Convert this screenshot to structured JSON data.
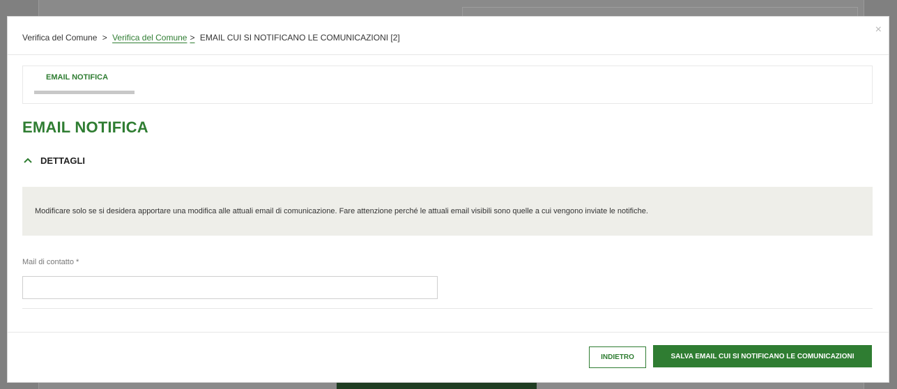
{
  "breadcrumb": {
    "items": [
      "Verifica del Comune",
      "Verifica del Comune",
      "EMAIL CUI SI NOTIFICANO LE COMUNICAZIONI [2]"
    ],
    "separator": ">"
  },
  "modal": {
    "close_symbol": "×"
  },
  "tabs": [
    {
      "label": "EMAIL NOTIFICA"
    }
  ],
  "section": {
    "title": "EMAIL NOTIFICA",
    "accordion_label": "DETTAGLI",
    "accordion_icon": "chevron-up-icon"
  },
  "info": {
    "text": "Modificare solo se si desidera apportare una modifica alle attuali email di comunicazione. Fare attenzione perché le attuali email visibili sono quelle a cui vengono inviate le notifiche."
  },
  "form": {
    "contact_mail": {
      "label": "Mail di contatto *",
      "value": "",
      "placeholder": ""
    }
  },
  "footer": {
    "back_label": "INDIETRO",
    "save_label": "SALVA EMAIL CUI SI NOTIFICANO LE COMUNICAZIONI"
  },
  "colors": {
    "accent": "#2f7d32",
    "info_bg": "#eeeee9",
    "overlay": "#808080"
  }
}
